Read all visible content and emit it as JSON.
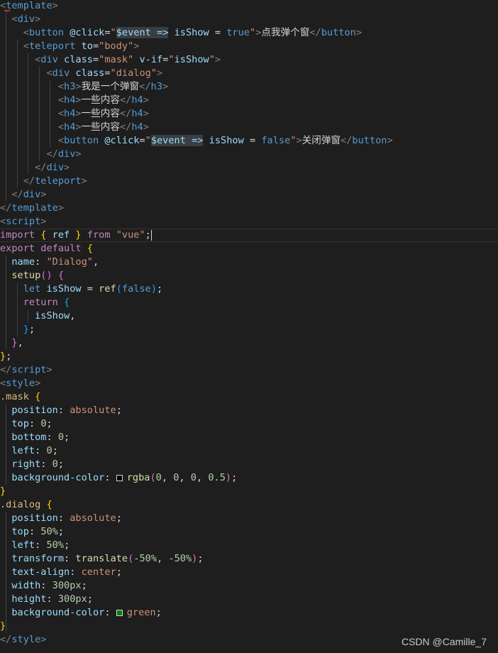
{
  "editor": {
    "colors": {
      "background": "#1e1e1e",
      "tag_bracket": "#808080",
      "tag": "#569cd6",
      "attribute": "#9cdcfe",
      "string": "#ce9178",
      "keyword_control": "#c586c0",
      "keyword": "#569cd6",
      "function": "#dcdcaa",
      "variable": "#9cdcfe",
      "number": "#b5cea8",
      "selector": "#d7ba7d",
      "property": "#9cdcfe",
      "css_value": "#ce9178",
      "text": "#d4d4d4",
      "bracket1": "#ffd700",
      "bracket2": "#da70d6",
      "bracket3": "#179fff"
    },
    "lines": [
      [
        {
          "t": "<",
          "c": "tag_bracket"
        },
        {
          "t": "template",
          "c": "tag"
        },
        {
          "t": ">",
          "c": "tag_bracket"
        }
      ],
      [
        {
          "t": "  "
        },
        {
          "t": "<",
          "c": "tag_bracket"
        },
        {
          "t": "div",
          "c": "tag"
        },
        {
          "t": ">",
          "c": "tag_bracket"
        }
      ],
      [
        {
          "t": "    "
        },
        {
          "t": "<",
          "c": "tag_bracket"
        },
        {
          "t": "button",
          "c": "tag"
        },
        {
          "t": " "
        },
        {
          "t": "@click",
          "c": "attribute"
        },
        {
          "t": "=",
          "c": "text"
        },
        {
          "t": "\"",
          "c": "string"
        },
        {
          "t": "$event =>",
          "c": "variable",
          "hl": true
        },
        {
          "t": " isShow",
          "c": "variable"
        },
        {
          "t": " = ",
          "c": "text"
        },
        {
          "t": "true",
          "c": "keyword"
        },
        {
          "t": "\"",
          "c": "string"
        },
        {
          "t": ">",
          "c": "tag_bracket"
        },
        {
          "t": "点我弹个窗",
          "c": "text"
        },
        {
          "t": "</",
          "c": "tag_bracket"
        },
        {
          "t": "button",
          "c": "tag"
        },
        {
          "t": ">",
          "c": "tag_bracket"
        }
      ],
      [
        {
          "t": "    "
        },
        {
          "t": "<",
          "c": "tag_bracket"
        },
        {
          "t": "teleport",
          "c": "tag"
        },
        {
          "t": " "
        },
        {
          "t": "to",
          "c": "attribute"
        },
        {
          "t": "=",
          "c": "text"
        },
        {
          "t": "\"body\"",
          "c": "string"
        },
        {
          "t": ">",
          "c": "tag_bracket"
        }
      ],
      [
        {
          "t": "      "
        },
        {
          "t": "<",
          "c": "tag_bracket"
        },
        {
          "t": "div",
          "c": "tag"
        },
        {
          "t": " "
        },
        {
          "t": "class",
          "c": "attribute"
        },
        {
          "t": "=",
          "c": "text"
        },
        {
          "t": "\"mask\"",
          "c": "string"
        },
        {
          "t": " "
        },
        {
          "t": "v-if",
          "c": "attribute"
        },
        {
          "t": "=",
          "c": "text"
        },
        {
          "t": "\"",
          "c": "string"
        },
        {
          "t": "isShow",
          "c": "variable"
        },
        {
          "t": "\"",
          "c": "string"
        },
        {
          "t": ">",
          "c": "tag_bracket"
        }
      ],
      [
        {
          "t": "        "
        },
        {
          "t": "<",
          "c": "tag_bracket"
        },
        {
          "t": "div",
          "c": "tag"
        },
        {
          "t": " "
        },
        {
          "t": "class",
          "c": "attribute"
        },
        {
          "t": "=",
          "c": "text"
        },
        {
          "t": "\"dialog\"",
          "c": "string"
        },
        {
          "t": ">",
          "c": "tag_bracket"
        }
      ],
      [
        {
          "t": "          "
        },
        {
          "t": "<",
          "c": "tag_bracket"
        },
        {
          "t": "h3",
          "c": "tag"
        },
        {
          "t": ">",
          "c": "tag_bracket"
        },
        {
          "t": "我是一个弹窗",
          "c": "text"
        },
        {
          "t": "</",
          "c": "tag_bracket"
        },
        {
          "t": "h3",
          "c": "tag"
        },
        {
          "t": ">",
          "c": "tag_bracket"
        }
      ],
      [
        {
          "t": "          "
        },
        {
          "t": "<",
          "c": "tag_bracket"
        },
        {
          "t": "h4",
          "c": "tag"
        },
        {
          "t": ">",
          "c": "tag_bracket"
        },
        {
          "t": "一些内容",
          "c": "text"
        },
        {
          "t": "</",
          "c": "tag_bracket"
        },
        {
          "t": "h4",
          "c": "tag"
        },
        {
          "t": ">",
          "c": "tag_bracket"
        }
      ],
      [
        {
          "t": "          "
        },
        {
          "t": "<",
          "c": "tag_bracket"
        },
        {
          "t": "h4",
          "c": "tag"
        },
        {
          "t": ">",
          "c": "tag_bracket"
        },
        {
          "t": "一些内容",
          "c": "text"
        },
        {
          "t": "</",
          "c": "tag_bracket"
        },
        {
          "t": "h4",
          "c": "tag"
        },
        {
          "t": ">",
          "c": "tag_bracket"
        }
      ],
      [
        {
          "t": "          "
        },
        {
          "t": "<",
          "c": "tag_bracket"
        },
        {
          "t": "h4",
          "c": "tag"
        },
        {
          "t": ">",
          "c": "tag_bracket"
        },
        {
          "t": "一些内容",
          "c": "text"
        },
        {
          "t": "</",
          "c": "tag_bracket"
        },
        {
          "t": "h4",
          "c": "tag"
        },
        {
          "t": ">",
          "c": "tag_bracket"
        }
      ],
      [
        {
          "t": "          "
        },
        {
          "t": "<",
          "c": "tag_bracket"
        },
        {
          "t": "button",
          "c": "tag"
        },
        {
          "t": " "
        },
        {
          "t": "@click",
          "c": "attribute"
        },
        {
          "t": "=",
          "c": "text"
        },
        {
          "t": "\"",
          "c": "string"
        },
        {
          "t": "$event =>",
          "c": "variable",
          "hl": true
        },
        {
          "t": " isShow",
          "c": "variable"
        },
        {
          "t": " = ",
          "c": "text"
        },
        {
          "t": "false",
          "c": "keyword"
        },
        {
          "t": "\"",
          "c": "string"
        },
        {
          "t": ">",
          "c": "tag_bracket"
        },
        {
          "t": "关闭弹窗",
          "c": "text"
        },
        {
          "t": "</",
          "c": "tag_bracket"
        },
        {
          "t": "button",
          "c": "tag"
        },
        {
          "t": ">",
          "c": "tag_bracket"
        }
      ],
      [
        {
          "t": "        "
        },
        {
          "t": "</",
          "c": "tag_bracket"
        },
        {
          "t": "div",
          "c": "tag"
        },
        {
          "t": ">",
          "c": "tag_bracket"
        }
      ],
      [
        {
          "t": "      "
        },
        {
          "t": "</",
          "c": "tag_bracket"
        },
        {
          "t": "div",
          "c": "tag"
        },
        {
          "t": ">",
          "c": "tag_bracket"
        }
      ],
      [
        {
          "t": "    "
        },
        {
          "t": "</",
          "c": "tag_bracket"
        },
        {
          "t": "teleport",
          "c": "tag"
        },
        {
          "t": ">",
          "c": "tag_bracket"
        }
      ],
      [
        {
          "t": "  "
        },
        {
          "t": "</",
          "c": "tag_bracket"
        },
        {
          "t": "div",
          "c": "tag"
        },
        {
          "t": ">",
          "c": "tag_bracket"
        }
      ],
      [
        {
          "t": "</",
          "c": "tag_bracket"
        },
        {
          "t": "template",
          "c": "tag"
        },
        {
          "t": ">",
          "c": "tag_bracket"
        }
      ],
      [
        {
          "t": "<",
          "c": "tag_bracket"
        },
        {
          "t": "script",
          "c": "tag"
        },
        {
          "t": ">",
          "c": "tag_bracket"
        }
      ],
      [
        {
          "t": "import",
          "c": "keyword_control"
        },
        {
          "t": " "
        },
        {
          "t": "{",
          "c": "bracket1"
        },
        {
          "t": " ref ",
          "c": "variable"
        },
        {
          "t": "}",
          "c": "bracket1"
        },
        {
          "t": " "
        },
        {
          "t": "from",
          "c": "keyword_control"
        },
        {
          "t": " "
        },
        {
          "t": "\"vue\"",
          "c": "string"
        },
        {
          "t": ";",
          "c": "text"
        },
        {
          "cursor": true
        }
      ],
      [
        {
          "t": "export",
          "c": "keyword_control"
        },
        {
          "t": " "
        },
        {
          "t": "default",
          "c": "keyword_control"
        },
        {
          "t": " "
        },
        {
          "t": "{",
          "c": "bracket1"
        }
      ],
      [
        {
          "t": "  "
        },
        {
          "t": "name",
          "c": "variable"
        },
        {
          "t": ": ",
          "c": "text"
        },
        {
          "t": "\"Dialog\"",
          "c": "string"
        },
        {
          "t": ",",
          "c": "text"
        }
      ],
      [
        {
          "t": "  "
        },
        {
          "t": "setup",
          "c": "function"
        },
        {
          "t": "()",
          "c": "bracket2"
        },
        {
          "t": " "
        },
        {
          "t": "{",
          "c": "bracket2"
        }
      ],
      [
        {
          "t": "    "
        },
        {
          "t": "let",
          "c": "keyword"
        },
        {
          "t": " "
        },
        {
          "t": "isShow",
          "c": "variable"
        },
        {
          "t": " = ",
          "c": "text"
        },
        {
          "t": "ref",
          "c": "function"
        },
        {
          "t": "(",
          "c": "bracket3"
        },
        {
          "t": "false",
          "c": "keyword"
        },
        {
          "t": ")",
          "c": "bracket3"
        },
        {
          "t": ";",
          "c": "text"
        }
      ],
      [
        {
          "t": "    "
        },
        {
          "t": "return",
          "c": "keyword_control"
        },
        {
          "t": " "
        },
        {
          "t": "{",
          "c": "bracket3"
        }
      ],
      [
        {
          "t": "      "
        },
        {
          "t": "isShow",
          "c": "variable"
        },
        {
          "t": ",",
          "c": "text"
        }
      ],
      [
        {
          "t": "    "
        },
        {
          "t": "}",
          "c": "bracket3"
        },
        {
          "t": ";",
          "c": "text"
        }
      ],
      [
        {
          "t": "  "
        },
        {
          "t": "}",
          "c": "bracket2"
        },
        {
          "t": ",",
          "c": "text"
        }
      ],
      [
        {
          "t": "}",
          "c": "bracket1"
        },
        {
          "t": ";",
          "c": "text"
        }
      ],
      [
        {
          "t": "</",
          "c": "tag_bracket"
        },
        {
          "t": "script",
          "c": "tag"
        },
        {
          "t": ">",
          "c": "tag_bracket"
        }
      ],
      [
        {
          "t": "<",
          "c": "tag_bracket"
        },
        {
          "t": "style",
          "c": "tag"
        },
        {
          "t": ">",
          "c": "tag_bracket"
        }
      ],
      [
        {
          "t": ".mask",
          "c": "selector"
        },
        {
          "t": " "
        },
        {
          "t": "{",
          "c": "bracket1"
        }
      ],
      [
        {
          "t": "  "
        },
        {
          "t": "position",
          "c": "property"
        },
        {
          "t": ": ",
          "c": "text"
        },
        {
          "t": "absolute",
          "c": "css_value"
        },
        {
          "t": ";",
          "c": "text"
        }
      ],
      [
        {
          "t": "  "
        },
        {
          "t": "top",
          "c": "property"
        },
        {
          "t": ": ",
          "c": "text"
        },
        {
          "t": "0",
          "c": "number"
        },
        {
          "t": ";",
          "c": "text"
        }
      ],
      [
        {
          "t": "  "
        },
        {
          "t": "bottom",
          "c": "property"
        },
        {
          "t": ": ",
          "c": "text"
        },
        {
          "t": "0",
          "c": "number"
        },
        {
          "t": ";",
          "c": "text"
        }
      ],
      [
        {
          "t": "  "
        },
        {
          "t": "left",
          "c": "property"
        },
        {
          "t": ": ",
          "c": "text"
        },
        {
          "t": "0",
          "c": "number"
        },
        {
          "t": ";",
          "c": "text"
        }
      ],
      [
        {
          "t": "  "
        },
        {
          "t": "right",
          "c": "property"
        },
        {
          "t": ": ",
          "c": "text"
        },
        {
          "t": "0",
          "c": "number"
        },
        {
          "t": ";",
          "c": "text"
        }
      ],
      [
        {
          "t": "  "
        },
        {
          "t": "background-color",
          "c": "property"
        },
        {
          "t": ": ",
          "c": "text"
        },
        {
          "swatch": "#000000"
        },
        {
          "t": "rgba",
          "c": "function"
        },
        {
          "t": "(",
          "c": "bracket2"
        },
        {
          "t": "0",
          "c": "number"
        },
        {
          "t": ", ",
          "c": "text"
        },
        {
          "t": "0",
          "c": "number"
        },
        {
          "t": ", ",
          "c": "text"
        },
        {
          "t": "0",
          "c": "number"
        },
        {
          "t": ", ",
          "c": "text"
        },
        {
          "t": "0.5",
          "c": "number"
        },
        {
          "t": ")",
          "c": "bracket2"
        },
        {
          "t": ";",
          "c": "text"
        }
      ],
      [
        {
          "t": "}",
          "c": "bracket1"
        }
      ],
      [
        {
          "t": ".dialog",
          "c": "selector"
        },
        {
          "t": " "
        },
        {
          "t": "{",
          "c": "bracket1"
        }
      ],
      [
        {
          "t": "  "
        },
        {
          "t": "position",
          "c": "property"
        },
        {
          "t": ": ",
          "c": "text"
        },
        {
          "t": "absolute",
          "c": "css_value"
        },
        {
          "t": ";",
          "c": "text"
        }
      ],
      [
        {
          "t": "  "
        },
        {
          "t": "top",
          "c": "property"
        },
        {
          "t": ": ",
          "c": "text"
        },
        {
          "t": "50%",
          "c": "number"
        },
        {
          "t": ";",
          "c": "text"
        }
      ],
      [
        {
          "t": "  "
        },
        {
          "t": "left",
          "c": "property"
        },
        {
          "t": ": ",
          "c": "text"
        },
        {
          "t": "50%",
          "c": "number"
        },
        {
          "t": ";",
          "c": "text"
        }
      ],
      [
        {
          "t": "  "
        },
        {
          "t": "transform",
          "c": "property"
        },
        {
          "t": ": ",
          "c": "text"
        },
        {
          "t": "translate",
          "c": "function"
        },
        {
          "t": "(",
          "c": "bracket2"
        },
        {
          "t": "-50%",
          "c": "number"
        },
        {
          "t": ", ",
          "c": "text"
        },
        {
          "t": "-50%",
          "c": "number"
        },
        {
          "t": ")",
          "c": "bracket2"
        },
        {
          "t": ";",
          "c": "text"
        }
      ],
      [
        {
          "t": "  "
        },
        {
          "t": "text-align",
          "c": "property"
        },
        {
          "t": ": ",
          "c": "text"
        },
        {
          "t": "center",
          "c": "css_value"
        },
        {
          "t": ";",
          "c": "text"
        }
      ],
      [
        {
          "t": "  "
        },
        {
          "t": "width",
          "c": "property"
        },
        {
          "t": ": ",
          "c": "text"
        },
        {
          "t": "300px",
          "c": "number"
        },
        {
          "t": ";",
          "c": "text"
        }
      ],
      [
        {
          "t": "  "
        },
        {
          "t": "height",
          "c": "property"
        },
        {
          "t": ": ",
          "c": "text"
        },
        {
          "t": "300px",
          "c": "number"
        },
        {
          "t": ";",
          "c": "text"
        }
      ],
      [
        {
          "t": "  "
        },
        {
          "t": "background-color",
          "c": "property"
        },
        {
          "t": ": ",
          "c": "text"
        },
        {
          "swatch": "#008000"
        },
        {
          "t": "green",
          "c": "css_value"
        },
        {
          "t": ";",
          "c": "text"
        }
      ],
      [
        {
          "t": "}",
          "c": "bracket1"
        }
      ],
      [
        {
          "t": "</",
          "c": "tag_bracket"
        },
        {
          "t": "style",
          "c": "tag"
        },
        {
          "t": ">",
          "c": "tag_bracket"
        }
      ]
    ]
  },
  "watermark": "CSDN @Camille_7"
}
